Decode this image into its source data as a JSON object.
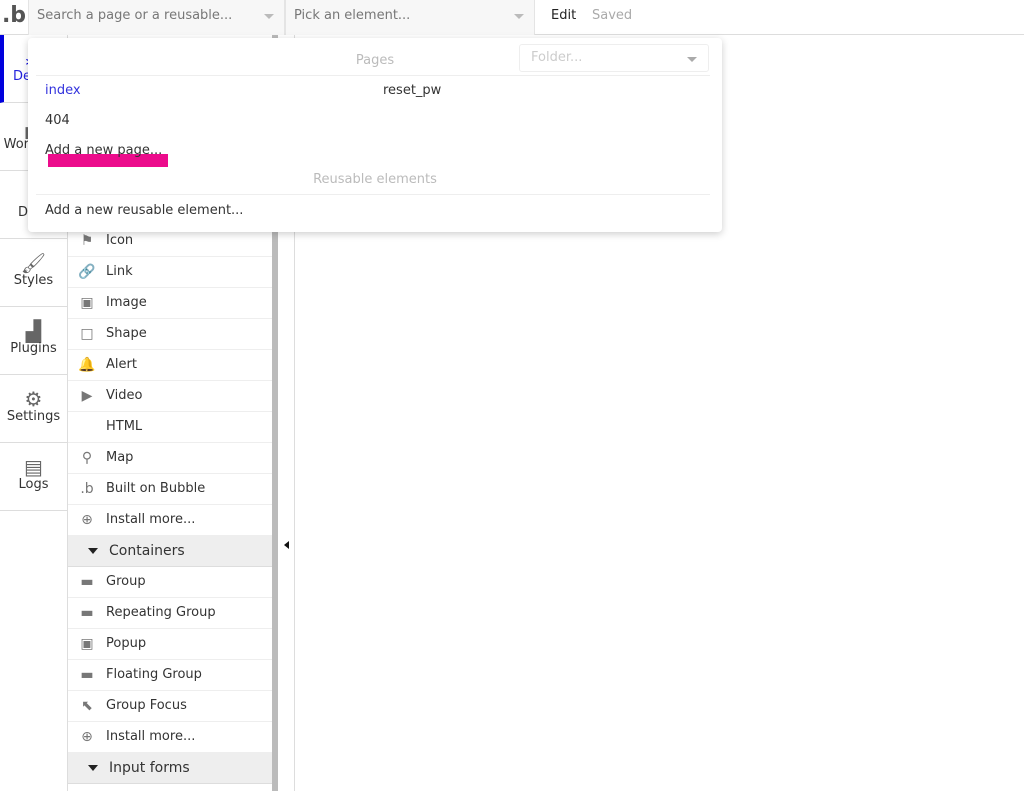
{
  "topbar": {
    "logo": ".b",
    "search_placeholder": "Search a page or a reusable...",
    "element_picker": "Pick an element...",
    "edit": "Edit",
    "status": "Saved"
  },
  "nav": [
    {
      "label": "Design",
      "icon": "design-icon",
      "active": true
    },
    {
      "label": "Workflow",
      "icon": "workflow-icon"
    },
    {
      "label": "Data",
      "icon": "data-icon"
    },
    {
      "label": "Styles",
      "icon": "brush-icon"
    },
    {
      "label": "Plugins",
      "icon": "plug-icon"
    },
    {
      "label": "Settings",
      "icon": "gear-icon"
    },
    {
      "label": "Logs",
      "icon": "document-icon"
    }
  ],
  "elements": {
    "visual": [
      {
        "label": "Icon",
        "icon": "flag-icon"
      },
      {
        "label": "Link",
        "icon": "link-icon"
      },
      {
        "label": "Image",
        "icon": "image-icon"
      },
      {
        "label": "Shape",
        "icon": "square-icon"
      },
      {
        "label": "Alert",
        "icon": "bell-icon"
      },
      {
        "label": "Video",
        "icon": "video-icon"
      },
      {
        "label": "HTML",
        "icon": "code-icon"
      },
      {
        "label": "Map",
        "icon": "map-pin-icon"
      },
      {
        "label": "Built on Bubble",
        "icon": "bubble-logo-icon"
      },
      {
        "label": "Install more...",
        "icon": "plus-circle-icon"
      }
    ],
    "containers_header": "Containers",
    "containers": [
      {
        "label": "Group",
        "icon": "folder-icon"
      },
      {
        "label": "Repeating Group",
        "icon": "folders-icon"
      },
      {
        "label": "Popup",
        "icon": "popup-icon"
      },
      {
        "label": "Floating Group",
        "icon": "floating-folder-icon"
      },
      {
        "label": "Group Focus",
        "icon": "folder-cursor-icon"
      },
      {
        "label": "Install more...",
        "icon": "plus-circle-icon"
      }
    ],
    "input_header": "Input forms"
  },
  "dropdown": {
    "pages_header": "Pages",
    "folder_placeholder": "Folder...",
    "pages": [
      "index",
      "reset_pw",
      "404"
    ],
    "add_page": "Add a new page...",
    "reusable_header": "Reusable elements",
    "add_reusable": "Add a new reusable element...",
    "highlight_color": "#ec0c8c",
    "active_page_color": "#3333dd"
  }
}
